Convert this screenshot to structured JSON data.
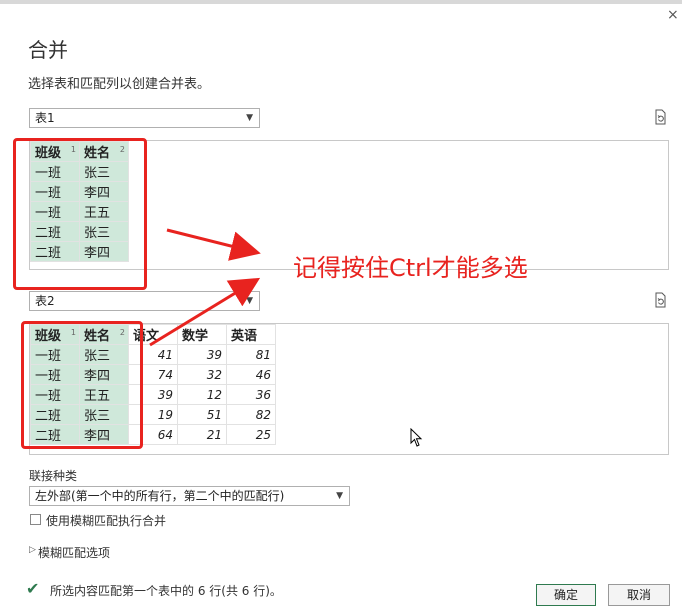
{
  "dialog": {
    "title": "合并",
    "subtitle": "选择表和匹配列以创建合并表。",
    "close_icon": "×"
  },
  "table1": {
    "selected": "表1",
    "columns": [
      {
        "name": "班级",
        "idx": "1"
      },
      {
        "name": "姓名",
        "idx": "2"
      }
    ],
    "rows": [
      [
        "一班",
        "张三"
      ],
      [
        "一班",
        "李四"
      ],
      [
        "一班",
        "王五"
      ],
      [
        "二班",
        "张三"
      ],
      [
        "二班",
        "李四"
      ]
    ]
  },
  "table2": {
    "selected": "表2",
    "columns": [
      {
        "name": "班级",
        "idx": "1"
      },
      {
        "name": "姓名",
        "idx": "2"
      },
      {
        "name": "语文",
        "idx": ""
      },
      {
        "name": "数学",
        "idx": ""
      },
      {
        "name": "英语",
        "idx": ""
      }
    ],
    "rows": [
      [
        "一班",
        "张三",
        "41",
        "39",
        "81"
      ],
      [
        "一班",
        "李四",
        "74",
        "32",
        "46"
      ],
      [
        "一班",
        "王五",
        "39",
        "12",
        "36"
      ],
      [
        "二班",
        "张三",
        "19",
        "51",
        "82"
      ],
      [
        "二班",
        "李四",
        "64",
        "21",
        "25"
      ]
    ]
  },
  "annotation": {
    "text": "记得按住Ctrl才能多选",
    "color": "#e8231f"
  },
  "join": {
    "label": "联接种类",
    "selected": "左外部(第一个中的所有行，第二个中的匹配行)",
    "fuzzy_checkbox_label": "使用模糊匹配执行合并",
    "fuzzy_checked": false,
    "fuzzy_options_label": "模糊匹配选项"
  },
  "footer": {
    "status": "所选内容匹配第一个表中的 6 行(共 6 行)。",
    "ok_label": "确定",
    "cancel_label": "取消"
  },
  "colors": {
    "selection": "#cfe8da",
    "accent": "#2f7a4f",
    "annotation": "#e8231f"
  }
}
